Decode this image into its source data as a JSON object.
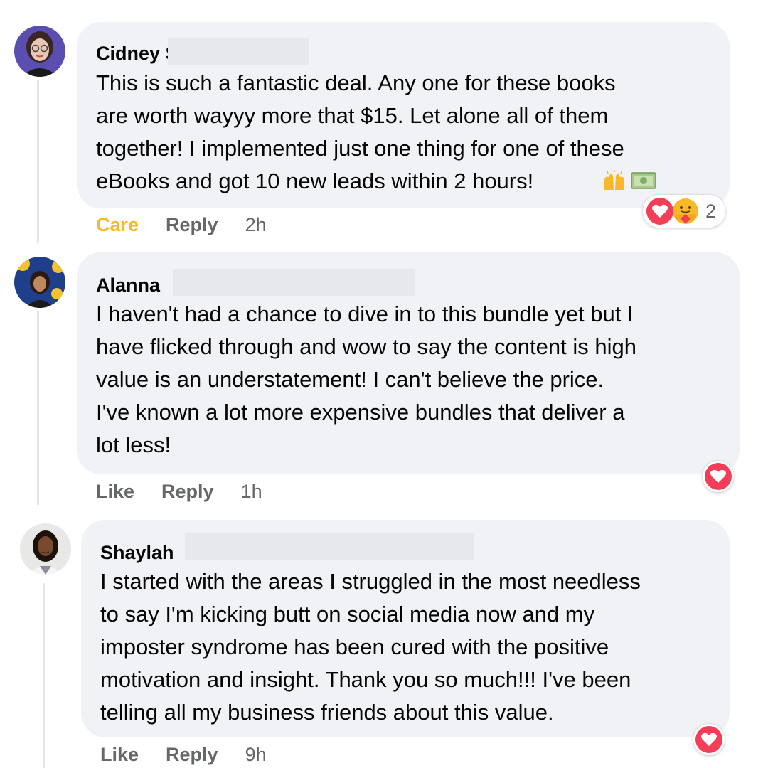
{
  "comments": [
    {
      "author": "Cidney S",
      "text": "This is such a fantastic deal. Any one for these books\nare worth wayyy more that $15. Let alone all of them\ntogether! I implemented just one thing for one of these\neBooks and got 10 new leads within 2 hours!",
      "emoji_icons": [
        "raising-hands-icon",
        "money-icon"
      ],
      "actions": {
        "like": "Care",
        "reply": "Reply",
        "time": "2h"
      },
      "reaction_icons": [
        "heart-icon",
        "care-face-icon"
      ],
      "reaction_count": "2",
      "colors": {
        "like_label": "#f7b928"
      }
    },
    {
      "author": "Alanna",
      "text": "I haven't had a chance to dive in to this bundle yet but I\nhave flicked through and wow to say the content is high\nvalue is an understatement! I can't believe the price.\nI've known a lot more expensive bundles that deliver a\nlot less!",
      "actions": {
        "like": "Like",
        "reply": "Reply",
        "time": "1h"
      },
      "reaction_icons": [
        "heart-icon"
      ]
    },
    {
      "author": "Shaylah",
      "text": "I started with the areas I struggled in the most needless\nto say I'm kicking butt on social media now and my\nimposter syndrome has been cured with the positive\nmotivation and insight. Thank you so much!!! I've been\ntelling all my business friends about this value.",
      "actions": {
        "like": "Like",
        "reply": "Reply",
        "time": "9h"
      },
      "reaction_icons": [
        "heart-icon"
      ]
    }
  ],
  "colors": {
    "bubble": "#f0f2f5",
    "meta": "#65676b",
    "heart": "#f33e58"
  }
}
